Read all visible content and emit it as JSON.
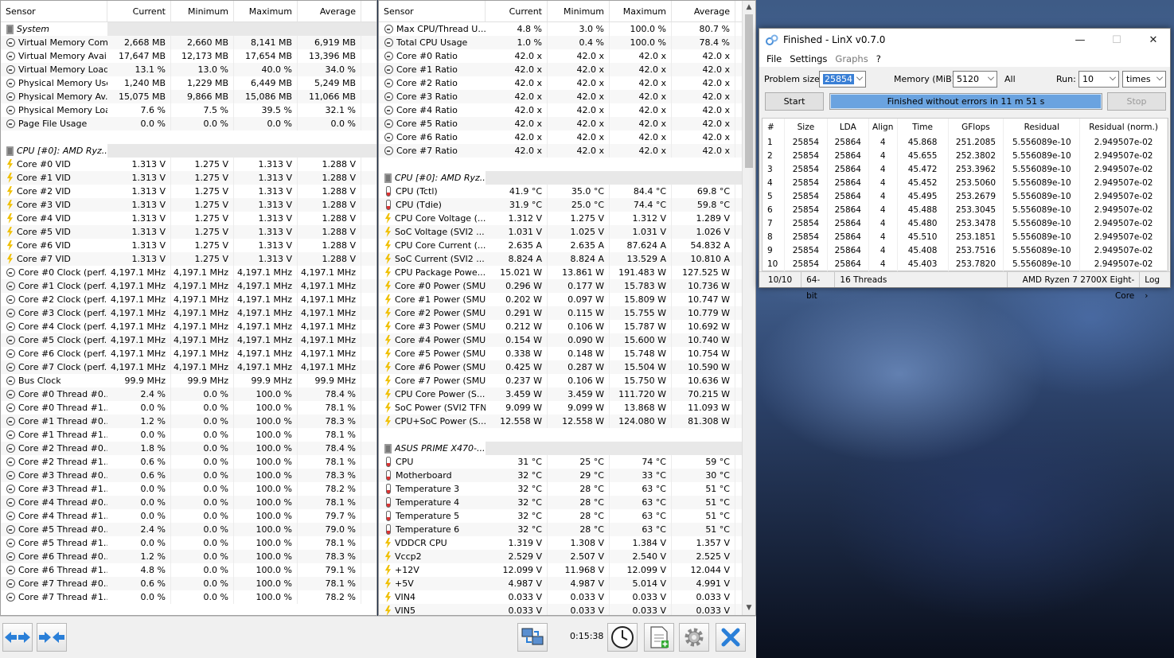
{
  "left_panel": {
    "headers": [
      "Sensor",
      "Current",
      "Minimum",
      "Maximum",
      "Average"
    ],
    "rows": [
      {
        "type": "group",
        "name": "System"
      },
      {
        "icon": "circle",
        "name": "Virtual Memory Com...",
        "cur": "2,668 MB",
        "min": "2,660 MB",
        "max": "8,141 MB",
        "avg": "6,919 MB"
      },
      {
        "icon": "circle",
        "name": "Virtual Memory Avai...",
        "cur": "17,647 MB",
        "min": "12,173 MB",
        "max": "17,654 MB",
        "avg": "13,396 MB"
      },
      {
        "icon": "circle",
        "name": "Virtual Memory Load",
        "cur": "13.1 %",
        "min": "13.0 %",
        "max": "40.0 %",
        "avg": "34.0 %"
      },
      {
        "icon": "circle",
        "name": "Physical Memory Used",
        "cur": "1,240 MB",
        "min": "1,229 MB",
        "max": "6,449 MB",
        "avg": "5,249 MB"
      },
      {
        "icon": "circle",
        "name": "Physical Memory Av...",
        "cur": "15,075 MB",
        "min": "9,866 MB",
        "max": "15,086 MB",
        "avg": "11,066 MB"
      },
      {
        "icon": "circle",
        "name": "Physical Memory Load",
        "cur": "7.6 %",
        "min": "7.5 %",
        "max": "39.5 %",
        "avg": "32.1 %"
      },
      {
        "icon": "circle",
        "name": "Page File Usage",
        "cur": "0.0 %",
        "min": "0.0 %",
        "max": "0.0 %",
        "avg": "0.0 %"
      },
      {
        "type": "blank"
      },
      {
        "type": "group",
        "name": "CPU [#0]: AMD Ryz..."
      },
      {
        "icon": "bolt",
        "name": "Core #0 VID",
        "cur": "1.313 V",
        "min": "1.275 V",
        "max": "1.313 V",
        "avg": "1.288 V"
      },
      {
        "icon": "bolt",
        "name": "Core #1 VID",
        "cur": "1.313 V",
        "min": "1.275 V",
        "max": "1.313 V",
        "avg": "1.288 V"
      },
      {
        "icon": "bolt",
        "name": "Core #2 VID",
        "cur": "1.313 V",
        "min": "1.275 V",
        "max": "1.313 V",
        "avg": "1.288 V"
      },
      {
        "icon": "bolt",
        "name": "Core #3 VID",
        "cur": "1.313 V",
        "min": "1.275 V",
        "max": "1.313 V",
        "avg": "1.288 V"
      },
      {
        "icon": "bolt",
        "name": "Core #4 VID",
        "cur": "1.313 V",
        "min": "1.275 V",
        "max": "1.313 V",
        "avg": "1.288 V"
      },
      {
        "icon": "bolt",
        "name": "Core #5 VID",
        "cur": "1.313 V",
        "min": "1.275 V",
        "max": "1.313 V",
        "avg": "1.288 V"
      },
      {
        "icon": "bolt",
        "name": "Core #6 VID",
        "cur": "1.313 V",
        "min": "1.275 V",
        "max": "1.313 V",
        "avg": "1.288 V"
      },
      {
        "icon": "bolt",
        "name": "Core #7 VID",
        "cur": "1.313 V",
        "min": "1.275 V",
        "max": "1.313 V",
        "avg": "1.288 V"
      },
      {
        "icon": "circle",
        "name": "Core #0 Clock (perf...",
        "cur": "4,197.1 MHz",
        "min": "4,197.1 MHz",
        "max": "4,197.1 MHz",
        "avg": "4,197.1 MHz"
      },
      {
        "icon": "circle",
        "name": "Core #1 Clock (perf...",
        "cur": "4,197.1 MHz",
        "min": "4,197.1 MHz",
        "max": "4,197.1 MHz",
        "avg": "4,197.1 MHz"
      },
      {
        "icon": "circle",
        "name": "Core #2 Clock (perf...",
        "cur": "4,197.1 MHz",
        "min": "4,197.1 MHz",
        "max": "4,197.1 MHz",
        "avg": "4,197.1 MHz"
      },
      {
        "icon": "circle",
        "name": "Core #3 Clock (perf...",
        "cur": "4,197.1 MHz",
        "min": "4,197.1 MHz",
        "max": "4,197.1 MHz",
        "avg": "4,197.1 MHz"
      },
      {
        "icon": "circle",
        "name": "Core #4 Clock (perf...",
        "cur": "4,197.1 MHz",
        "min": "4,197.1 MHz",
        "max": "4,197.1 MHz",
        "avg": "4,197.1 MHz"
      },
      {
        "icon": "circle",
        "name": "Core #5 Clock (perf...",
        "cur": "4,197.1 MHz",
        "min": "4,197.1 MHz",
        "max": "4,197.1 MHz",
        "avg": "4,197.1 MHz"
      },
      {
        "icon": "circle",
        "name": "Core #6 Clock (perf...",
        "cur": "4,197.1 MHz",
        "min": "4,197.1 MHz",
        "max": "4,197.1 MHz",
        "avg": "4,197.1 MHz"
      },
      {
        "icon": "circle",
        "name": "Core #7 Clock (perf...",
        "cur": "4,197.1 MHz",
        "min": "4,197.1 MHz",
        "max": "4,197.1 MHz",
        "avg": "4,197.1 MHz"
      },
      {
        "icon": "circle",
        "name": "Bus Clock",
        "cur": "99.9 MHz",
        "min": "99.9 MHz",
        "max": "99.9 MHz",
        "avg": "99.9 MHz"
      },
      {
        "icon": "circle",
        "name": "Core #0 Thread #0...",
        "cur": "2.4 %",
        "min": "0.0 %",
        "max": "100.0 %",
        "avg": "78.4 %"
      },
      {
        "icon": "circle",
        "name": "Core #0 Thread #1...",
        "cur": "0.0 %",
        "min": "0.0 %",
        "max": "100.0 %",
        "avg": "78.1 %"
      },
      {
        "icon": "circle",
        "name": "Core #1 Thread #0...",
        "cur": "1.2 %",
        "min": "0.0 %",
        "max": "100.0 %",
        "avg": "78.3 %"
      },
      {
        "icon": "circle",
        "name": "Core #1 Thread #1...",
        "cur": "0.0 %",
        "min": "0.0 %",
        "max": "100.0 %",
        "avg": "78.1 %"
      },
      {
        "icon": "circle",
        "name": "Core #2 Thread #0...",
        "cur": "1.8 %",
        "min": "0.0 %",
        "max": "100.0 %",
        "avg": "78.4 %"
      },
      {
        "icon": "circle",
        "name": "Core #2 Thread #1...",
        "cur": "0.6 %",
        "min": "0.0 %",
        "max": "100.0 %",
        "avg": "78.1 %"
      },
      {
        "icon": "circle",
        "name": "Core #3 Thread #0...",
        "cur": "0.6 %",
        "min": "0.0 %",
        "max": "100.0 %",
        "avg": "78.3 %"
      },
      {
        "icon": "circle",
        "name": "Core #3 Thread #1...",
        "cur": "0.0 %",
        "min": "0.0 %",
        "max": "100.0 %",
        "avg": "78.2 %"
      },
      {
        "icon": "circle",
        "name": "Core #4 Thread #0...",
        "cur": "0.0 %",
        "min": "0.0 %",
        "max": "100.0 %",
        "avg": "78.1 %"
      },
      {
        "icon": "circle",
        "name": "Core #4 Thread #1...",
        "cur": "0.0 %",
        "min": "0.0 %",
        "max": "100.0 %",
        "avg": "79.7 %"
      },
      {
        "icon": "circle",
        "name": "Core #5 Thread #0...",
        "cur": "2.4 %",
        "min": "0.0 %",
        "max": "100.0 %",
        "avg": "79.0 %"
      },
      {
        "icon": "circle",
        "name": "Core #5 Thread #1...",
        "cur": "0.0 %",
        "min": "0.0 %",
        "max": "100.0 %",
        "avg": "78.1 %"
      },
      {
        "icon": "circle",
        "name": "Core #6 Thread #0...",
        "cur": "1.2 %",
        "min": "0.0 %",
        "max": "100.0 %",
        "avg": "78.3 %"
      },
      {
        "icon": "circle",
        "name": "Core #6 Thread #1...",
        "cur": "4.8 %",
        "min": "0.0 %",
        "max": "100.0 %",
        "avg": "79.1 %"
      },
      {
        "icon": "circle",
        "name": "Core #7 Thread #0...",
        "cur": "0.6 %",
        "min": "0.0 %",
        "max": "100.0 %",
        "avg": "78.1 %"
      },
      {
        "icon": "circle",
        "name": "Core #7 Thread #1...",
        "cur": "0.0 %",
        "min": "0.0 %",
        "max": "100.0 %",
        "avg": "78.2 %"
      }
    ]
  },
  "right_panel": {
    "headers": [
      "Sensor",
      "Current",
      "Minimum",
      "Maximum",
      "Average"
    ],
    "rows": [
      {
        "icon": "circle",
        "name": "Max CPU/Thread U...",
        "cur": "4.8 %",
        "min": "3.0 %",
        "max": "100.0 %",
        "avg": "80.7 %"
      },
      {
        "icon": "circle",
        "name": "Total CPU Usage",
        "cur": "1.0 %",
        "min": "0.4 %",
        "max": "100.0 %",
        "avg": "78.4 %"
      },
      {
        "icon": "circle",
        "name": "Core #0 Ratio",
        "cur": "42.0 x",
        "min": "42.0 x",
        "max": "42.0 x",
        "avg": "42.0 x"
      },
      {
        "icon": "circle",
        "name": "Core #1 Ratio",
        "cur": "42.0 x",
        "min": "42.0 x",
        "max": "42.0 x",
        "avg": "42.0 x"
      },
      {
        "icon": "circle",
        "name": "Core #2 Ratio",
        "cur": "42.0 x",
        "min": "42.0 x",
        "max": "42.0 x",
        "avg": "42.0 x"
      },
      {
        "icon": "circle",
        "name": "Core #3 Ratio",
        "cur": "42.0 x",
        "min": "42.0 x",
        "max": "42.0 x",
        "avg": "42.0 x"
      },
      {
        "icon": "circle",
        "name": "Core #4 Ratio",
        "cur": "42.0 x",
        "min": "42.0 x",
        "max": "42.0 x",
        "avg": "42.0 x"
      },
      {
        "icon": "circle",
        "name": "Core #5 Ratio",
        "cur": "42.0 x",
        "min": "42.0 x",
        "max": "42.0 x",
        "avg": "42.0 x"
      },
      {
        "icon": "circle",
        "name": "Core #6 Ratio",
        "cur": "42.0 x",
        "min": "42.0 x",
        "max": "42.0 x",
        "avg": "42.0 x"
      },
      {
        "icon": "circle",
        "name": "Core #7 Ratio",
        "cur": "42.0 x",
        "min": "42.0 x",
        "max": "42.0 x",
        "avg": "42.0 x"
      },
      {
        "type": "blank"
      },
      {
        "type": "group",
        "name": "CPU [#0]: AMD Ryz..."
      },
      {
        "icon": "therm",
        "name": "CPU (Tctl)",
        "cur": "41.9 °C",
        "min": "35.0 °C",
        "max": "84.4 °C",
        "avg": "69.8 °C"
      },
      {
        "icon": "therm",
        "name": "CPU (Tdie)",
        "cur": "31.9 °C",
        "min": "25.0 °C",
        "max": "74.4 °C",
        "avg": "59.8 °C"
      },
      {
        "icon": "bolt",
        "name": "CPU Core Voltage (...",
        "cur": "1.312 V",
        "min": "1.275 V",
        "max": "1.312 V",
        "avg": "1.289 V"
      },
      {
        "icon": "bolt",
        "name": "SoC Voltage (SVI2 ...",
        "cur": "1.031 V",
        "min": "1.025 V",
        "max": "1.031 V",
        "avg": "1.026 V"
      },
      {
        "icon": "bolt",
        "name": "CPU Core Current (...",
        "cur": "2.635 A",
        "min": "2.635 A",
        "max": "87.624 A",
        "avg": "54.832 A"
      },
      {
        "icon": "bolt",
        "name": "SoC Current (SVI2 ...",
        "cur": "8.824 A",
        "min": "8.824 A",
        "max": "13.529 A",
        "avg": "10.810 A"
      },
      {
        "icon": "bolt",
        "name": "CPU Package Powe...",
        "cur": "15.021 W",
        "min": "13.861 W",
        "max": "191.483 W",
        "avg": "127.525 W"
      },
      {
        "icon": "bolt",
        "name": "Core #0 Power (SMU)",
        "cur": "0.296 W",
        "min": "0.177 W",
        "max": "15.783 W",
        "avg": "10.736 W"
      },
      {
        "icon": "bolt",
        "name": "Core #1 Power (SMU)",
        "cur": "0.202 W",
        "min": "0.097 W",
        "max": "15.809 W",
        "avg": "10.747 W"
      },
      {
        "icon": "bolt",
        "name": "Core #2 Power (SMU)",
        "cur": "0.291 W",
        "min": "0.115 W",
        "max": "15.755 W",
        "avg": "10.779 W"
      },
      {
        "icon": "bolt",
        "name": "Core #3 Power (SMU)",
        "cur": "0.212 W",
        "min": "0.106 W",
        "max": "15.787 W",
        "avg": "10.692 W"
      },
      {
        "icon": "bolt",
        "name": "Core #4 Power (SMU)",
        "cur": "0.154 W",
        "min": "0.090 W",
        "max": "15.600 W",
        "avg": "10.740 W"
      },
      {
        "icon": "bolt",
        "name": "Core #5 Power (SMU)",
        "cur": "0.338 W",
        "min": "0.148 W",
        "max": "15.748 W",
        "avg": "10.754 W"
      },
      {
        "icon": "bolt",
        "name": "Core #6 Power (SMU)",
        "cur": "0.425 W",
        "min": "0.287 W",
        "max": "15.504 W",
        "avg": "10.590 W"
      },
      {
        "icon": "bolt",
        "name": "Core #7 Power (SMU)",
        "cur": "0.237 W",
        "min": "0.106 W",
        "max": "15.750 W",
        "avg": "10.636 W"
      },
      {
        "icon": "bolt",
        "name": "CPU Core Power (S...",
        "cur": "3.459 W",
        "min": "3.459 W",
        "max": "111.720 W",
        "avg": "70.215 W"
      },
      {
        "icon": "bolt",
        "name": "SoC Power (SVI2 TFN)",
        "cur": "9.099 W",
        "min": "9.099 W",
        "max": "13.868 W",
        "avg": "11.093 W"
      },
      {
        "icon": "bolt",
        "name": "CPU+SoC Power (S...",
        "cur": "12.558 W",
        "min": "12.558 W",
        "max": "124.080 W",
        "avg": "81.308 W"
      },
      {
        "type": "blank"
      },
      {
        "type": "group",
        "name": "ASUS PRIME X470-..."
      },
      {
        "icon": "therm",
        "name": "CPU",
        "cur": "31 °C",
        "min": "25 °C",
        "max": "74 °C",
        "avg": "59 °C"
      },
      {
        "icon": "therm",
        "name": "Motherboard",
        "cur": "32 °C",
        "min": "29 °C",
        "max": "33 °C",
        "avg": "30 °C"
      },
      {
        "icon": "therm",
        "name": "Temperature 3",
        "cur": "32 °C",
        "min": "28 °C",
        "max": "63 °C",
        "avg": "51 °C"
      },
      {
        "icon": "therm",
        "name": "Temperature 4",
        "cur": "32 °C",
        "min": "28 °C",
        "max": "63 °C",
        "avg": "51 °C"
      },
      {
        "icon": "therm",
        "name": "Temperature 5",
        "cur": "32 °C",
        "min": "28 °C",
        "max": "63 °C",
        "avg": "51 °C"
      },
      {
        "icon": "therm",
        "name": "Temperature 6",
        "cur": "32 °C",
        "min": "28 °C",
        "max": "63 °C",
        "avg": "51 °C"
      },
      {
        "icon": "bolt",
        "name": "VDDCR CPU",
        "cur": "1.319 V",
        "min": "1.308 V",
        "max": "1.384 V",
        "avg": "1.357 V"
      },
      {
        "icon": "bolt",
        "name": "Vccp2",
        "cur": "2.529 V",
        "min": "2.507 V",
        "max": "2.540 V",
        "avg": "2.525 V"
      },
      {
        "icon": "bolt",
        "name": "+12V",
        "cur": "12.099 V",
        "min": "11.968 V",
        "max": "12.099 V",
        "avg": "12.044 V"
      },
      {
        "icon": "bolt",
        "name": "+5V",
        "cur": "4.987 V",
        "min": "4.987 V",
        "max": "5.014 V",
        "avg": "4.991 V"
      },
      {
        "icon": "bolt",
        "name": "VIN4",
        "cur": "0.033 V",
        "min": "0.033 V",
        "max": "0.033 V",
        "avg": "0.033 V"
      },
      {
        "icon": "bolt",
        "name": "VIN5",
        "cur": "0.033 V",
        "min": "0.033 V",
        "max": "0.033 V",
        "avg": "0.033 V"
      }
    ]
  },
  "toolbar": {
    "timer": "0:15:38"
  },
  "linx": {
    "title": "Finished - LinX v0.7.0",
    "menu": [
      "File",
      "Settings",
      "Graphs",
      "?"
    ],
    "problem_size_label": "Problem size:",
    "problem_size": "25854",
    "memory_label": "Memory (MiB):",
    "memory": "5120",
    "all_label": "All",
    "run_label": "Run:",
    "run": "10",
    "run_unit": "times",
    "start_label": "Start",
    "stop_label": "Stop",
    "progress_text": "Finished without errors in 11 m 51 s",
    "table_headers": [
      "#",
      "Size",
      "LDA",
      "Align",
      "Time",
      "GFlops",
      "Residual",
      "Residual (norm.)"
    ],
    "table_rows": [
      [
        "1",
        "25854",
        "25864",
        "4",
        "45.868",
        "251.2085",
        "5.556089e-10",
        "2.949507e-02"
      ],
      [
        "2",
        "25854",
        "25864",
        "4",
        "45.655",
        "252.3802",
        "5.556089e-10",
        "2.949507e-02"
      ],
      [
        "3",
        "25854",
        "25864",
        "4",
        "45.472",
        "253.3962",
        "5.556089e-10",
        "2.949507e-02"
      ],
      [
        "4",
        "25854",
        "25864",
        "4",
        "45.452",
        "253.5060",
        "5.556089e-10",
        "2.949507e-02"
      ],
      [
        "5",
        "25854",
        "25864",
        "4",
        "45.495",
        "253.2679",
        "5.556089e-10",
        "2.949507e-02"
      ],
      [
        "6",
        "25854",
        "25864",
        "4",
        "45.488",
        "253.3045",
        "5.556089e-10",
        "2.949507e-02"
      ],
      [
        "7",
        "25854",
        "25864",
        "4",
        "45.480",
        "253.3478",
        "5.556089e-10",
        "2.949507e-02"
      ],
      [
        "8",
        "25854",
        "25864",
        "4",
        "45.510",
        "253.1851",
        "5.556089e-10",
        "2.949507e-02"
      ],
      [
        "9",
        "25854",
        "25864",
        "4",
        "45.408",
        "253.7516",
        "5.556089e-10",
        "2.949507e-02"
      ],
      [
        "10",
        "25854",
        "25864",
        "4",
        "45.403",
        "253.7820",
        "5.556089e-10",
        "2.949507e-02"
      ]
    ],
    "status": {
      "progress": "10/10",
      "bits": "64-bit",
      "threads": "16 Threads",
      "cpu": "AMD Ryzen 7 2700X Eight-Core",
      "log": "Log ›"
    }
  }
}
